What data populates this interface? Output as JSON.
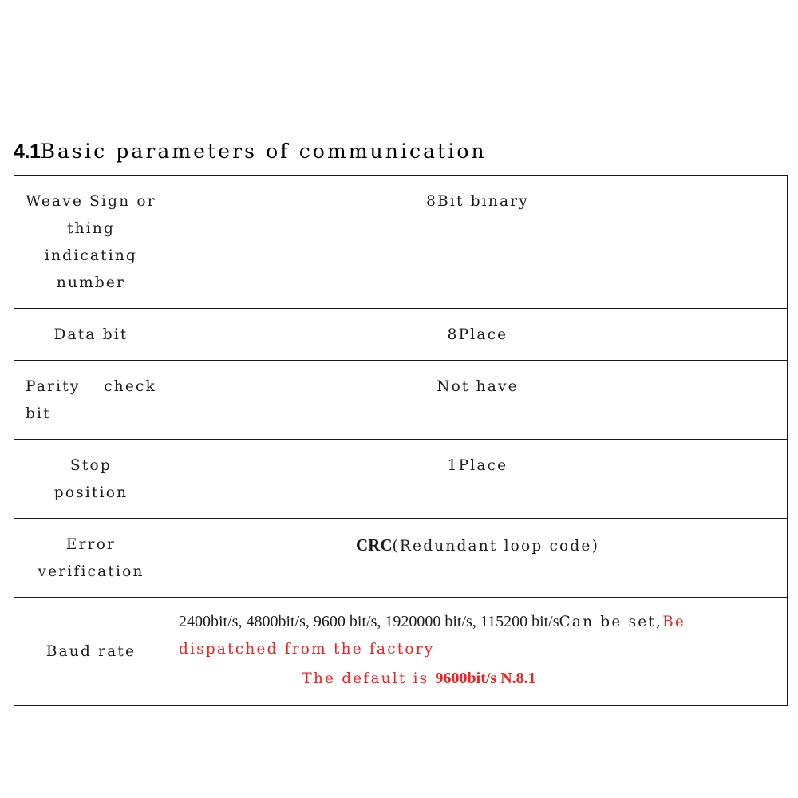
{
  "heading": {
    "number": "4.1",
    "title": "Basic parameters of communication"
  },
  "table": {
    "rows": [
      {
        "label": "Weave Sign or thing indicating number",
        "label_lines": [
          "Weave Sign or",
          "thing",
          "indicating",
          "number"
        ],
        "value": "8Bit binary"
      },
      {
        "label": "Data bit",
        "label_lines": [
          "Data bit"
        ],
        "value": "8Place"
      },
      {
        "label": "Parity check bit",
        "label_lines": [
          "Parity   check",
          "bit"
        ],
        "value": "Not have"
      },
      {
        "label": "Stop position",
        "label_lines": [
          "Stop",
          "position"
        ],
        "value": "1Place"
      },
      {
        "label": "Error verification",
        "label_lines": [
          "Error",
          "verification"
        ],
        "value_bold": "CRC",
        "value_rest": "(Redundant loop code)"
      },
      {
        "label": "Baud rate",
        "label_lines": [
          "Baud rate"
        ],
        "baud": {
          "rates": "2400bit/s, 4800bit/s, 9600 bit/s, 1920000 bit/s, 115200 bit/s",
          "can_be_set": "Can be set,",
          "note_red_part1": "Be dispatched from the factory",
          "default_prefix": "The default is ",
          "default_value": "9600bit/s N.8.1"
        }
      }
    ]
  },
  "colors": {
    "text": "#1c1c1c",
    "accent_red": "#ee2222",
    "border": "#1a1a1a",
    "background": "#ffffff"
  }
}
